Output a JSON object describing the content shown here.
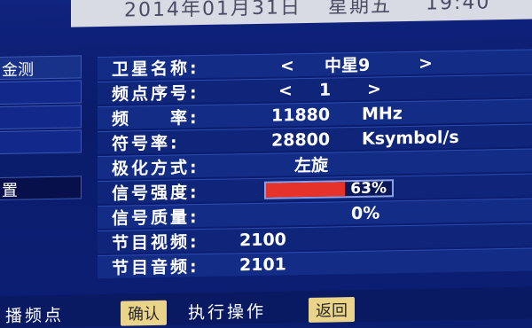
{
  "topbar": {
    "date": "2014年01月31日",
    "weekday": "星期五",
    "time": "19:40"
  },
  "sidebar": {
    "items": [
      {
        "label": "金测"
      },
      {
        "label": ""
      },
      {
        "label": ""
      },
      {
        "label": ""
      },
      {
        "label": "置"
      }
    ]
  },
  "details": {
    "satellite_name": {
      "label": "卫星名称:",
      "prev": "<",
      "value": "中星9",
      "next": ">"
    },
    "transponder_index": {
      "label": "频点序号:",
      "prev": "<",
      "value": "1",
      "next": ">"
    },
    "frequency": {
      "label": "频　　率:",
      "value": "11880",
      "unit": "MHz"
    },
    "symbol_rate": {
      "label": "符号率:",
      "value": "28800",
      "unit": "Ksymbol/s"
    },
    "polarization": {
      "label": "极化方式:",
      "value": "左旋"
    },
    "signal_strength": {
      "label": "信号强度:",
      "value": "63%",
      "level": 0.63
    },
    "signal_quality": {
      "label": "信号质量:",
      "value": "0%"
    },
    "video_pid": {
      "label": "节目视频:",
      "value": "2100"
    },
    "audio_pid": {
      "label": "节目音频:",
      "value": "2101"
    }
  },
  "bottombar": {
    "left_text": "播频点",
    "confirm_label": "确认",
    "confirm_action": "执行操作",
    "back_label": "返回"
  },
  "colors": {
    "strength_fill": "#e5322a",
    "button_bg": "#ead48a",
    "panel_bg": "#0c1f74"
  }
}
